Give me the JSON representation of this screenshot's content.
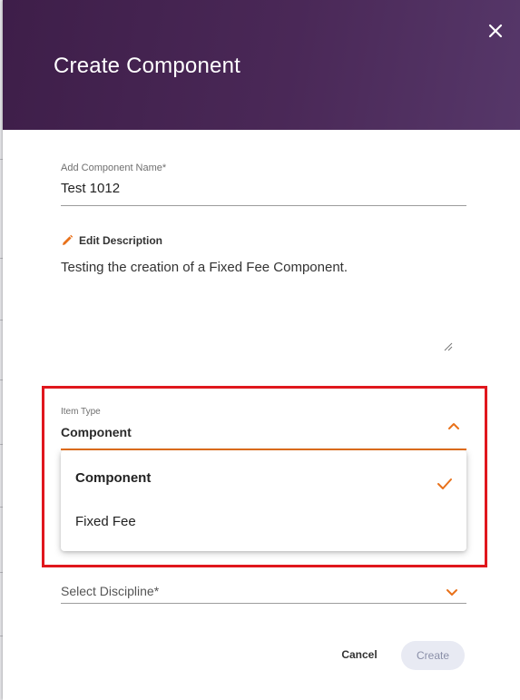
{
  "dialog": {
    "title": "Create Component",
    "close_icon": "close-icon"
  },
  "component_name": {
    "label": "Add Component Name*",
    "value": "Test 1012"
  },
  "description": {
    "edit_label": "Edit Description",
    "edit_icon": "pencil-icon",
    "text": "Testing the creation of a Fixed Fee Component."
  },
  "item_type": {
    "label": "Item Type",
    "value": "Component",
    "options": [
      {
        "label": "Component",
        "selected": true
      },
      {
        "label": "Fixed Fee",
        "selected": false
      }
    ]
  },
  "discipline": {
    "placeholder": "Select Discipline*"
  },
  "actions": {
    "cancel_label": "Cancel",
    "create_label": "Create"
  },
  "colors": {
    "header_start": "#3e1e49",
    "header_end": "#563769",
    "accent": "#e8711a",
    "highlight": "#e0171d"
  }
}
